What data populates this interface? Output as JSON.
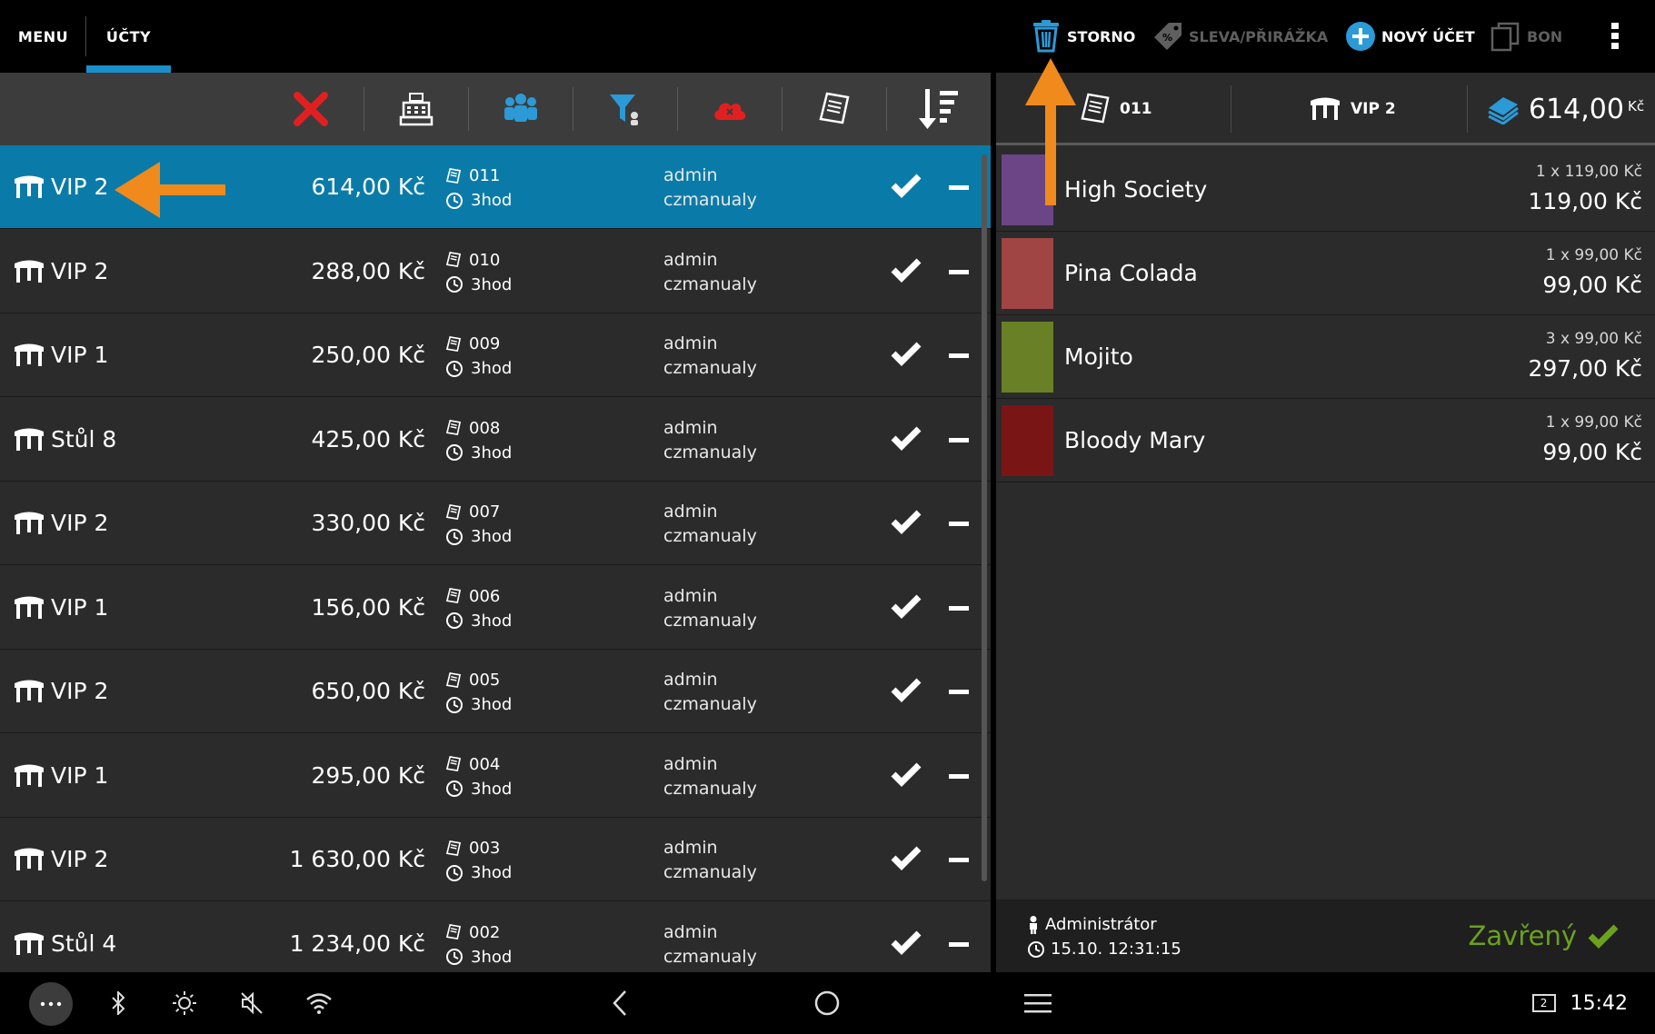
{
  "topbar": {
    "tabs": [
      {
        "label": "MENU"
      },
      {
        "label": "ÚČTY"
      }
    ],
    "actions": {
      "storno": "STORNO",
      "sleva": "SLEVA/PŘIRÁŽKA",
      "novy_ucet": "NOVÝ ÚČET",
      "bon": "BON"
    }
  },
  "toolbar": {
    "tools": [
      "close-icon",
      "cash-register-icon",
      "group-icon",
      "filter-icon",
      "cloud-icon",
      "receipt-icon",
      "sort-icon"
    ]
  },
  "accounts": [
    {
      "table": "VIP 2",
      "amount": "614,00 Kč",
      "number": "011",
      "time": "3hod",
      "user": "admin",
      "device": "czmanualy",
      "selected": true
    },
    {
      "table": "VIP 2",
      "amount": "288,00 Kč",
      "number": "010",
      "time": "3hod",
      "user": "admin",
      "device": "czmanualy"
    },
    {
      "table": "VIP 1",
      "amount": "250,00 Kč",
      "number": "009",
      "time": "3hod",
      "user": "admin",
      "device": "czmanualy"
    },
    {
      "table": "Stůl 8",
      "amount": "425,00 Kč",
      "number": "008",
      "time": "3hod",
      "user": "admin",
      "device": "czmanualy"
    },
    {
      "table": "VIP 2",
      "amount": "330,00 Kč",
      "number": "007",
      "time": "3hod",
      "user": "admin",
      "device": "czmanualy"
    },
    {
      "table": "VIP 1",
      "amount": "156,00 Kč",
      "number": "006",
      "time": "3hod",
      "user": "admin",
      "device": "czmanualy"
    },
    {
      "table": "VIP 2",
      "amount": "650,00 Kč",
      "number": "005",
      "time": "3hod",
      "user": "admin",
      "device": "czmanualy"
    },
    {
      "table": "VIP 1",
      "amount": "295,00 Kč",
      "number": "004",
      "time": "3hod",
      "user": "admin",
      "device": "czmanualy"
    },
    {
      "table": "VIP 2",
      "amount": "1 630,00 Kč",
      "number": "003",
      "time": "3hod",
      "user": "admin",
      "device": "czmanualy"
    },
    {
      "table": "Stůl 4",
      "amount": "1 234,00 Kč",
      "number": "002",
      "time": "3hod",
      "user": "admin",
      "device": "czmanualy"
    }
  ],
  "bill": {
    "number": "011",
    "table": "VIP 2",
    "total": "614,00",
    "currency": "Kč",
    "items": [
      {
        "name": "High Society",
        "qty": "1 x 119,00 Kč",
        "price": "119,00 Kč",
        "color": "#6b4586"
      },
      {
        "name": "Pina Colada",
        "qty": "1 x 99,00 Kč",
        "price": "99,00 Kč",
        "color": "#a04444"
      },
      {
        "name": "Mojito",
        "qty": "3 x 99,00 Kč",
        "price": "297,00 Kč",
        "color": "#6a8026"
      },
      {
        "name": "Bloody Mary",
        "qty": "1 x 99,00 Kč",
        "price": "99,00 Kč",
        "color": "#7a1515"
      }
    ],
    "footer": {
      "user": "Administrátor",
      "datetime": "15.10. 12:31:15",
      "status": "Zavřený"
    }
  },
  "system": {
    "clock": "15:42",
    "notification_count": "2"
  },
  "colors": {
    "accent": "#1a8fc9",
    "selected_row": "#0a7ba9",
    "closed_status": "#6aa21e",
    "annotation": "#f08a1c"
  }
}
